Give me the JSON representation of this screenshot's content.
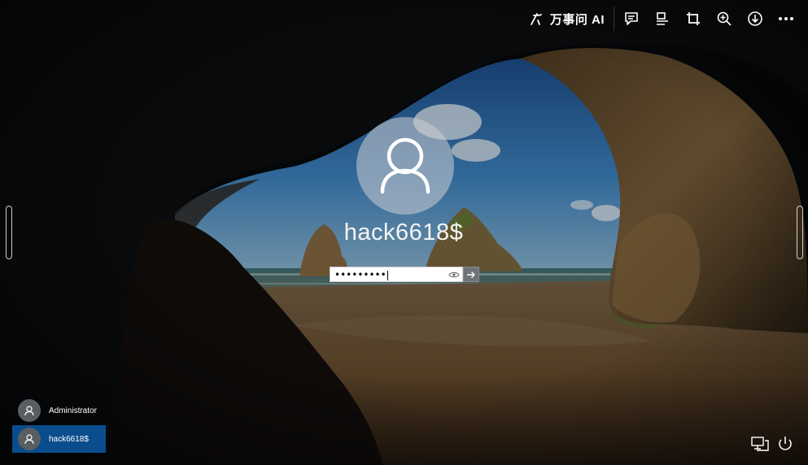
{
  "toolbar": {
    "ai_label": "万事问 AI",
    "icons": [
      "ai-sparkle-icon",
      "comment-icon",
      "align-icon",
      "crop-icon",
      "zoom-in-icon",
      "download-icon",
      "more-icon"
    ]
  },
  "login": {
    "username": "hack6618$",
    "password_masked": "•••••••••",
    "submit_icon": "arrow-right-icon",
    "reveal_icon": "eye-icon"
  },
  "users": [
    {
      "name": "Administrator",
      "selected": false
    },
    {
      "name": "hack6618$",
      "selected": true
    }
  ],
  "system_icons": [
    "network-icon",
    "power-icon"
  ],
  "colors": {
    "selected_user": "#0a4d8c",
    "avatar_bg": "#cdcdd2",
    "background": "#05070a"
  }
}
